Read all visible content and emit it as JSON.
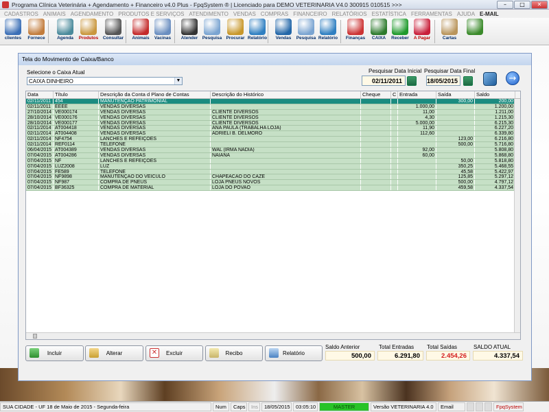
{
  "window": {
    "title": "Programa Clínica Veterinária + Agendamento + Financeiro v4.0 Plus - FpqSystem ® | Licenciado para  DEMO VETERINARIA V4.0 300915 010515 >>>",
    "minimize": "–",
    "maximize": "□",
    "close": "✕"
  },
  "menu": [
    "CADASTROS",
    "ANIMAIS",
    "AGENDAMENTO",
    "PRODUTOS E SERVIÇOS",
    "ATENDIMENTO",
    "VENDAS",
    "COMPRAS",
    "FINANCEIRO",
    "RELATÓRIOS",
    "ESTATÍSTICA",
    "FERRAMENTAS",
    "AJUDA"
  ],
  "menu_email": "E-MAIL",
  "toolbar": [
    {
      "label": "clientes",
      "icon": "clients-icon",
      "color": "#3b6fb6"
    },
    {
      "label": "Fornece",
      "icon": "supplier-icon",
      "color": "#c27c3c"
    },
    {
      "label": "Agenda",
      "icon": "calendar-icon",
      "color": "#4a8a9b"
    },
    {
      "label": "Produtos",
      "icon": "boxes-icon",
      "color": "#c9973e",
      "red": true
    },
    {
      "label": "Consultar",
      "icon": "barcode-icon",
      "color": "#555"
    },
    {
      "label": "Animais",
      "icon": "paw-icon",
      "color": "#c42a2a"
    },
    {
      "label": "Vacinas",
      "icon": "syringe-icon",
      "color": "#6a8ec0"
    },
    {
      "label": "Atender",
      "icon": "paw-icon",
      "color": "#333"
    },
    {
      "label": "Pesquisa",
      "icon": "search-icon",
      "color": "#7aa4d1"
    },
    {
      "label": "Procurar",
      "icon": "folder-icon",
      "color": "#c8972a"
    },
    {
      "label": "Relatório",
      "icon": "report-icon",
      "color": "#2f7fc1"
    },
    {
      "label": "Vendas",
      "icon": "monitor-icon",
      "color": "#2266a8"
    },
    {
      "label": "Pesquisa",
      "icon": "search-icon",
      "color": "#7aa4d1"
    },
    {
      "label": "Relatório",
      "icon": "report-icon",
      "color": "#2f7fc1"
    },
    {
      "label": "Finanças",
      "icon": "finance-icon",
      "color": "#c33"
    },
    {
      "label": "CAIXA",
      "icon": "cashbox-icon",
      "color": "#2c7a2c"
    },
    {
      "label": "Receber",
      "icon": "dollar-green-icon",
      "color": "#1f9a2c"
    },
    {
      "label": "A Pagar",
      "icon": "dollar-red-icon",
      "color": "#c91f3a",
      "red": true
    },
    {
      "label": "Cartas",
      "icon": "letter-icon",
      "color": "#b9955c"
    },
    {
      "label": "",
      "icon": "exit-icon",
      "color": "#3a8a2a"
    }
  ],
  "form": {
    "caption": "Tela do Movimento de Caixa/Banco",
    "caixa_label": "Selecione o Caixa Atual",
    "caixa_value": "CAIXA DINHEIRO",
    "date_start_label": "Pesquisar Data Inicial",
    "date_start": "02/11/2011",
    "date_end_label": "Pesquisar Data Final",
    "date_end": "18/05/2015"
  },
  "grid": {
    "columns": [
      "Data",
      "Título",
      "Descrição da Conta d Plano de Contas",
      "Descrição do Histórico",
      "Cheque",
      "C",
      "Entrada",
      "Saída",
      "Saldo"
    ],
    "rows": [
      [
        "02/11/2011",
        "454",
        "MANUTENÇÃO PATRIMONIAL",
        "",
        "",
        "",
        "",
        "300,00",
        "200,00"
      ],
      [
        "02/11/2011",
        "EEEE",
        "VENDAS DIVERSAS",
        "",
        "",
        "",
        "1.000,00",
        "",
        "1.200,00"
      ],
      [
        "27/10/2014",
        "VE000174",
        "VENDAS DIVERSAS",
        "CLIENTE DIVERSOS",
        "",
        "",
        "11,00",
        "",
        "1.211,00"
      ],
      [
        "28/10/2014",
        "VE000176",
        "VENDAS DIVERSAS",
        "CLIENTE DIVERSOS",
        "",
        "",
        "4,30",
        "",
        "1.215,30"
      ],
      [
        "28/10/2014",
        "VE000177",
        "VENDAS DIVERSAS",
        "CLIENTE DIVERSOS",
        "",
        "",
        "5.000,00",
        "",
        "6.215,30"
      ],
      [
        "02/11/2014",
        "AT004418",
        "VENDAS DIVERSAS",
        "ANA PAULA (TRABALHA LOJA)",
        "",
        "",
        "11,90",
        "",
        "6.227,20"
      ],
      [
        "02/11/2014",
        "AT004408",
        "VENDAS DIVERSAS",
        "ADRIELI B. DELMORO",
        "",
        "",
        "112,60",
        "",
        "6.339,80"
      ],
      [
        "02/11/2014",
        "NF4754",
        "LANCHES E REFEIÇÕES",
        "",
        "",
        "",
        "",
        "123,00",
        "6.216,80"
      ],
      [
        "02/11/2014",
        "REF0114",
        "TELEFONE",
        "",
        "",
        "",
        "",
        "500,00",
        "5.716,80"
      ],
      [
        "06/04/2015",
        "AT004389",
        "VENDAS DIVERSAS",
        "WAL (IRMA NADIA)",
        "",
        "",
        "92,00",
        "",
        "5.808,80"
      ],
      [
        "07/04/2015",
        "AT004286",
        "VENDAS DIVERSAS",
        "NAIANA",
        "",
        "",
        "60,00",
        "",
        "5.868,80"
      ],
      [
        "07/04/2015",
        "NF",
        "LANCHES E REFEIÇÕES",
        "",
        "",
        "",
        "",
        "50,00",
        "5.818,80"
      ],
      [
        "07/04/2015",
        "LUZ2008",
        "LUZ",
        "",
        "",
        "",
        "",
        "350,25",
        "5.468,55"
      ],
      [
        "07/04/2015",
        "FE589",
        "TELEFONE",
        "",
        "",
        "",
        "",
        "45,58",
        "5.422,97"
      ],
      [
        "07/04/2015",
        "NF9898",
        "MANUTENÇÃO DO VEÍCULO",
        "CHAPEACAO DO CAZE",
        "",
        "",
        "",
        "125,85",
        "5.297,12"
      ],
      [
        "07/04/2015",
        "NF987",
        "COMPRA DE PNEUS",
        "LOJA PNEUS NOVOS",
        "",
        "",
        "",
        "500,00",
        "4.797,12"
      ],
      [
        "07/04/2015",
        "BF36325",
        "COMPRA DE MATERIAL",
        "LOJA DO POVAO",
        "",
        "",
        "",
        "459,58",
        "4.337,54"
      ]
    ]
  },
  "actions": {
    "incluir": "Incluir",
    "alterar": "Alterar",
    "excluir": "Excluir",
    "recibo": "Recibo",
    "relatorio": "Relatório"
  },
  "totals": {
    "saldo_anterior_label": "Saldo Anterior",
    "saldo_anterior": "500,00",
    "total_entradas_label": "Total Entradas",
    "total_entradas": "6.291,80",
    "total_saidas_label": "Total Saídas",
    "total_saidas": "2.454,26",
    "saldo_atual_label": "SALDO ATUAL",
    "saldo_atual": "4.337,54"
  },
  "status": {
    "city": "SUA CIDADE - UF 18 de Maio de 2015 - Segunda-feira",
    "num": "Num",
    "caps": "Caps",
    "ins": "Ins",
    "date": "18/05/2015",
    "time": "03:05:10",
    "master": "MASTER",
    "version": "Versão VETERINARIA 4.0",
    "email": "Email",
    "brand": "FpqSystem"
  }
}
